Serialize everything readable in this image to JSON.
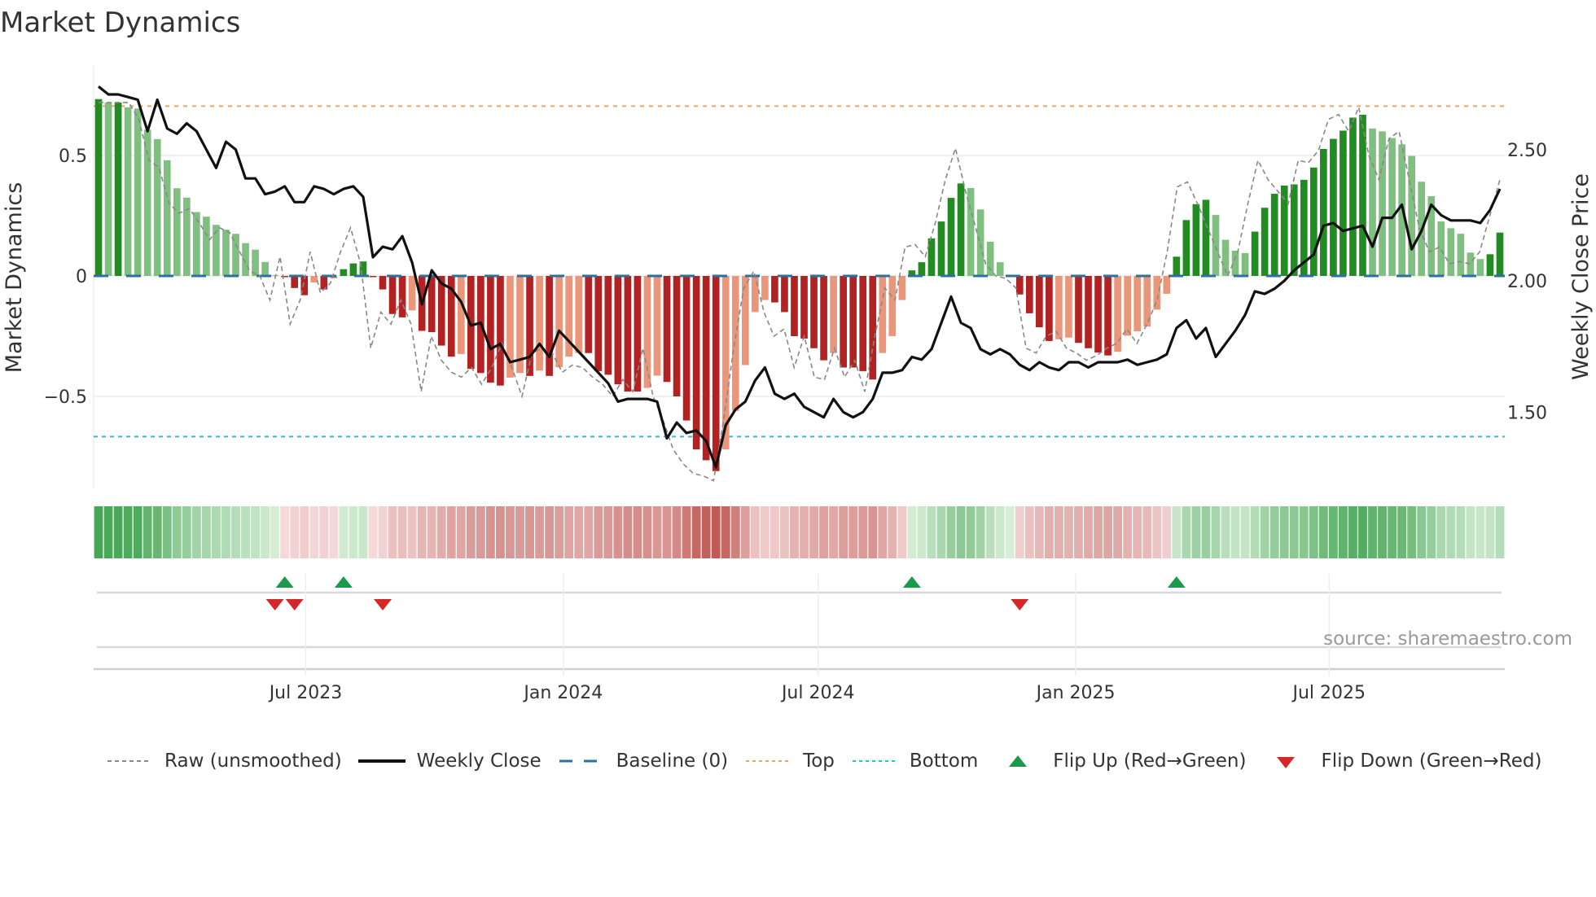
{
  "title": "Market Dynamics",
  "source": "source: sharemaestro.com",
  "chart_data": {
    "type": "bar",
    "title": "Market Dynamics",
    "ylabel": "Market Dynamics",
    "y2label": "Weekly Close Price",
    "x_start": "2023-02-03",
    "x_step_days": 7,
    "ylim": [
      -0.88,
      0.9
    ],
    "y2lim": [
      1.22,
      2.8
    ],
    "yticks": [
      {
        "v": 0.5,
        "label": "0.5"
      },
      {
        "v": 0,
        "label": "0"
      },
      {
        "v": -0.5,
        "label": "−0.5"
      }
    ],
    "y2ticks": [
      {
        "v": 2.5,
        "label": "2.50"
      },
      {
        "v": 2.0,
        "label": "2.00"
      },
      {
        "v": 1.5,
        "label": "1.50"
      }
    ],
    "xticks": [
      {
        "label": "Jul 2023",
        "date": "2023-07-01"
      },
      {
        "label": "Jan 2024",
        "date": "2024-01-01"
      },
      {
        "label": "Jul 2024",
        "date": "2024-07-01"
      },
      {
        "label": "Jan 2025",
        "date": "2025-01-01"
      },
      {
        "label": "Jul 2025",
        "date": "2025-07-01"
      }
    ],
    "top_level": 0.705,
    "bottom_level": -0.667,
    "baseline": 0,
    "colors": {
      "green_strong": "#228b22",
      "green_weak": "#7fbf7f",
      "red_strong": "#b22222",
      "red_weak": "#e9967a",
      "baseline": "#2b6fa3",
      "top": "#f4a460",
      "bottom": "#22c3d3",
      "close": "#111111",
      "raw": "#888888",
      "flip_up": "#1a9a4a",
      "flip_down": "#d62728"
    },
    "dynamics": [
      0.734,
      0.72,
      0.72,
      0.7,
      0.695,
      0.607,
      0.568,
      0.48,
      0.364,
      0.325,
      0.265,
      0.246,
      0.212,
      0.192,
      0.175,
      0.136,
      0.109,
      0.058,
      0.003,
      -0.005,
      -0.05,
      -0.08,
      -0.027,
      -0.056,
      -0.01,
      0.028,
      0.052,
      0.06,
      -0.005,
      -0.056,
      -0.158,
      -0.172,
      -0.143,
      -0.228,
      -0.233,
      -0.289,
      -0.335,
      -0.324,
      -0.386,
      -0.403,
      -0.443,
      -0.455,
      -0.422,
      -0.403,
      -0.415,
      -0.393,
      -0.415,
      -0.379,
      -0.335,
      -0.32,
      -0.32,
      -0.395,
      -0.41,
      -0.45,
      -0.48,
      -0.48,
      -0.465,
      -0.414,
      -0.44,
      -0.5,
      -0.6,
      -0.72,
      -0.765,
      -0.81,
      -0.72,
      -0.56,
      -0.37,
      -0.15,
      -0.1,
      -0.11,
      -0.15,
      -0.25,
      -0.26,
      -0.3,
      -0.35,
      -0.32,
      -0.38,
      -0.38,
      -0.395,
      -0.43,
      -0.32,
      -0.25,
      -0.1,
      0.023,
      0.057,
      0.156,
      0.226,
      0.324,
      0.384,
      0.365,
      0.276,
      0.142,
      0.057,
      0,
      -0.077,
      -0.155,
      -0.213,
      -0.27,
      -0.263,
      -0.256,
      -0.278,
      -0.3,
      -0.318,
      -0.33,
      -0.315,
      -0.248,
      -0.23,
      -0.21,
      -0.14,
      -0.074,
      0.08,
      0.232,
      0.298,
      0.316,
      0.253,
      0.15,
      0.105,
      0.095,
      0.184,
      0.283,
      0.341,
      0.375,
      0.38,
      0.399,
      0.45,
      0.527,
      0.569,
      0.603,
      0.657,
      0.669,
      0.612,
      0.6,
      0.572,
      0.546,
      0.498,
      0.391,
      0.331,
      0.226,
      0.198,
      0.175,
      0.097,
      0.07,
      0.09,
      0.18
    ],
    "raw": [
      0.72,
      0.72,
      0.72,
      0.72,
      0.65,
      0.48,
      0.45,
      0.3,
      0.26,
      0.28,
      0.22,
      0.15,
      0.2,
      0.18,
      0.1,
      0.02,
      0.0,
      -0.1,
      0.08,
      -0.2,
      -0.1,
      0.1,
      -0.07,
      -0.03,
      0.1,
      0.2,
      0.05,
      -0.3,
      -0.15,
      -0.2,
      -0.1,
      -0.2,
      -0.48,
      -0.25,
      -0.35,
      -0.4,
      -0.42,
      -0.38,
      -0.45,
      -0.38,
      -0.28,
      -0.38,
      -0.5,
      -0.32,
      -0.3,
      -0.32,
      -0.4,
      -0.37,
      -0.38,
      -0.42,
      -0.45,
      -0.5,
      -0.43,
      -0.48,
      -0.3,
      -0.5,
      -0.6,
      -0.72,
      -0.78,
      -0.82,
      -0.83,
      -0.85,
      -0.6,
      -0.3,
      -0.05,
      0.02,
      -0.15,
      -0.25,
      -0.22,
      -0.38,
      -0.25,
      -0.42,
      -0.43,
      -0.3,
      -0.42,
      -0.35,
      -0.48,
      -0.25,
      -0.05,
      -0.1,
      0.12,
      0.13,
      0.08,
      0.22,
      0.4,
      0.53,
      0.35,
      0.2,
      0.05,
      0.0,
      -0.01,
      -0.05,
      -0.3,
      -0.32,
      -0.25,
      -0.23,
      -0.3,
      -0.32,
      -0.35,
      -0.33,
      -0.3,
      -0.28,
      -0.22,
      -0.28,
      -0.2,
      -0.1,
      0.1,
      0.37,
      0.39,
      0.3,
      0.2,
      0.1,
      0.0,
      0.1,
      0.3,
      0.48,
      0.4,
      0.35,
      0.3,
      0.48,
      0.47,
      0.52,
      0.65,
      0.67,
      0.6,
      0.7,
      0.5,
      0.4,
      0.57,
      0.6,
      0.4,
      0.2,
      0.1,
      0.12,
      0.05,
      0.06,
      0.05,
      0.1,
      0.25,
      0.4
    ],
    "weekly_close": [
      2.74,
      2.71,
      2.71,
      2.7,
      2.69,
      2.57,
      2.69,
      2.58,
      2.56,
      2.6,
      2.57,
      2.5,
      2.43,
      2.53,
      2.5,
      2.39,
      2.39,
      2.33,
      2.34,
      2.36,
      2.3,
      2.3,
      2.36,
      2.35,
      2.33,
      2.35,
      2.36,
      2.32,
      2.09,
      2.13,
      2.12,
      2.17,
      2.07,
      1.91,
      2.04,
      1.99,
      1.97,
      1.92,
      1.83,
      1.84,
      1.74,
      1.76,
      1.69,
      1.7,
      1.71,
      1.76,
      1.71,
      1.81,
      1.77,
      1.73,
      1.69,
      1.65,
      1.61,
      1.54,
      1.55,
      1.55,
      1.55,
      1.54,
      1.4,
      1.46,
      1.42,
      1.43,
      1.39,
      1.29,
      1.45,
      1.51,
      1.54,
      1.62,
      1.67,
      1.57,
      1.55,
      1.57,
      1.52,
      1.5,
      1.48,
      1.55,
      1.5,
      1.48,
      1.5,
      1.55,
      1.65,
      1.65,
      1.66,
      1.71,
      1.7,
      1.74,
      1.84,
      1.94,
      1.84,
      1.82,
      1.74,
      1.72,
      1.74,
      1.72,
      1.68,
      1.66,
      1.69,
      1.67,
      1.66,
      1.69,
      1.69,
      1.67,
      1.69,
      1.69,
      1.69,
      1.7,
      1.68,
      1.69,
      1.7,
      1.72,
      1.82,
      1.85,
      1.78,
      1.82,
      1.71,
      1.76,
      1.81,
      1.87,
      1.96,
      1.95,
      1.97,
      2.0,
      2.04,
      2.07,
      2.1,
      2.21,
      2.22,
      2.19,
      2.2,
      2.21,
      2.13,
      2.24,
      2.24,
      2.29,
      2.12,
      2.19,
      2.29,
      2.25,
      2.23,
      2.23,
      2.23,
      2.22,
      2.27,
      2.35
    ],
    "flip_up_weeks": [
      19,
      25,
      83,
      110
    ],
    "flip_down_weeks": [
      18,
      20,
      29,
      94
    ],
    "legend": [
      {
        "key": "raw",
        "label": "Raw (unsmoothed)"
      },
      {
        "key": "close",
        "label": "Weekly Close"
      },
      {
        "key": "baseline",
        "label": "Baseline (0)"
      },
      {
        "key": "top",
        "label": "Top"
      },
      {
        "key": "bottom",
        "label": "Bottom"
      },
      {
        "key": "flip_up",
        "label": "Flip Up (Red→Green)"
      },
      {
        "key": "flip_down",
        "label": "Flip Down (Green→Red)"
      }
    ],
    "legend_position": "bottom"
  }
}
